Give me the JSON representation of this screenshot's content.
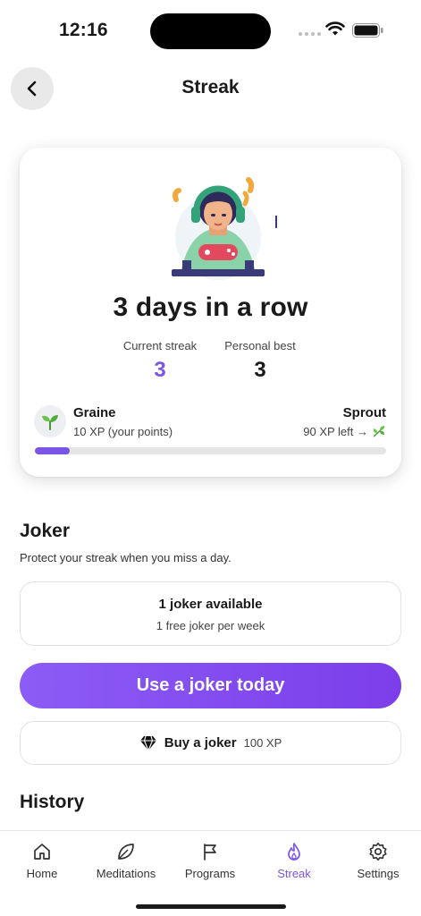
{
  "status_bar": {
    "time": "12:16"
  },
  "header": {
    "title": "Streak",
    "back_icon": "chevron-left-icon"
  },
  "streak_card": {
    "headline": "3 days in a row",
    "current_streak": {
      "label": "Current streak",
      "value": "3"
    },
    "personal_best": {
      "label": "Personal best",
      "value": "3"
    },
    "level": {
      "name": "Graine",
      "points": "10 XP (your points)",
      "next_name": "Sprout",
      "next_left": "90 XP left →",
      "progress": 0.1
    }
  },
  "joker": {
    "title": "Joker",
    "subtitle": "Protect your streak when you miss a day.",
    "available": "1 joker available",
    "free_info": "1 free joker per week",
    "use_button": "Use a joker today",
    "buy_label": "Buy a joker",
    "buy_cost": "100 XP"
  },
  "history": {
    "title": "History"
  },
  "tabs": [
    {
      "label": "Home",
      "icon": "home-icon",
      "active": false
    },
    {
      "label": "Meditations",
      "icon": "leaf-icon",
      "active": false
    },
    {
      "label": "Programs",
      "icon": "flag-icon",
      "active": false
    },
    {
      "label": "Streak",
      "icon": "flame-icon",
      "active": true
    },
    {
      "label": "Settings",
      "icon": "gear-icon",
      "active": false
    }
  ],
  "colors": {
    "accent": "#7a55e6",
    "button_gradient_start": "#8c5cf6",
    "button_gradient_end": "#7c3eea"
  }
}
